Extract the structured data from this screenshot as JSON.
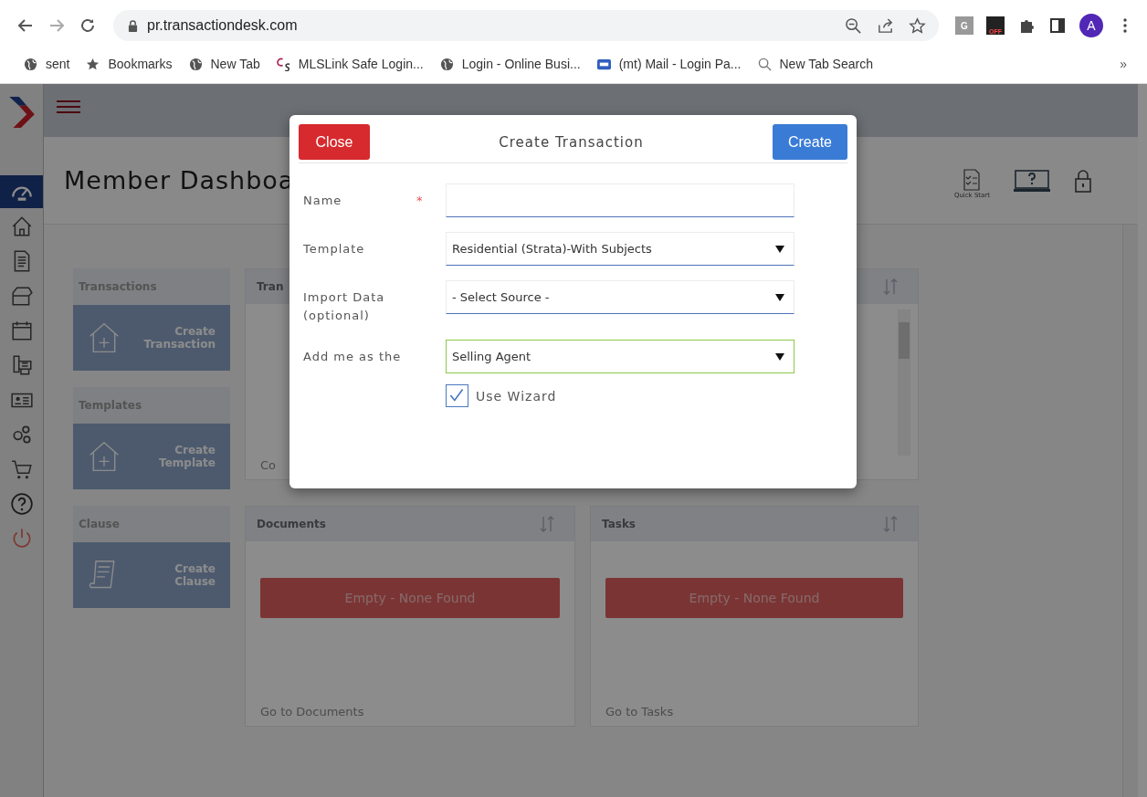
{
  "browser": {
    "url": "pr.transactiondesk.com",
    "extensions": [
      {
        "label": "G"
      },
      {
        "label": "OFF"
      }
    ],
    "avatar": "A",
    "bookmarks": [
      {
        "kind": "globe",
        "label": "sent"
      },
      {
        "kind": "star",
        "label": "Bookmarks"
      },
      {
        "kind": "globe",
        "label": "New Tab"
      },
      {
        "kind": "cs",
        "label": "MLSLink Safe Login..."
      },
      {
        "kind": "globe",
        "label": "Login - Online Busi..."
      },
      {
        "kind": "mail",
        "label": "(mt) Mail - Login Pa..."
      },
      {
        "kind": "search",
        "label": "New Tab Search"
      }
    ],
    "more": "»"
  },
  "sidebar": {
    "items": [
      {
        "kind": "gauge",
        "selected": true
      },
      {
        "kind": "home",
        "selected": false
      },
      {
        "kind": "doc",
        "selected": false
      },
      {
        "kind": "box",
        "selected": false
      },
      {
        "kind": "calendar",
        "selected": false
      },
      {
        "kind": "fax",
        "selected": false
      },
      {
        "kind": "card",
        "selected": false
      },
      {
        "kind": "gears",
        "selected": false
      },
      {
        "kind": "cart",
        "selected": false
      },
      {
        "kind": "help",
        "selected": false
      },
      {
        "kind": "power",
        "selected": false
      }
    ]
  },
  "header": {
    "title": "Member Dashboa",
    "quick_start": "Quick Start"
  },
  "tiles": [
    {
      "title": "Transactions",
      "action": "Create Transaction",
      "kind": "house"
    },
    {
      "title": "Templates",
      "action": "Create Template",
      "kind": "house"
    },
    {
      "title": "Clause",
      "action": "Create Clause",
      "kind": "scroll"
    }
  ],
  "panels": [
    {
      "title": "Tran",
      "footer": "Co"
    },
    {
      "scrollbar": true,
      "sortable": true
    },
    {
      "title": "Documents",
      "sortable": true,
      "empty": "Empty - None Found",
      "footer": "Go to Documents"
    },
    {
      "title": "Tasks",
      "sortable": true,
      "empty": "Empty - None Found",
      "footer": "Go to Tasks"
    }
  ],
  "dialog": {
    "title": "Create Transaction",
    "close": "Close",
    "create": "Create",
    "fields": [
      {
        "kind": "text",
        "label": "Name",
        "required_mark": "*",
        "valid": false
      },
      {
        "kind": "select",
        "label": "Template",
        "value": "Residential (Strata)-With Subjects",
        "valid": false
      },
      {
        "kind": "select",
        "label": "Import Data (optional)",
        "value": "- Select Source -",
        "valid": false
      },
      {
        "kind": "select",
        "label": "Add me as the",
        "value": "Selling Agent",
        "valid": true
      }
    ],
    "wizard": {
      "label": "Use Wizard",
      "checked": true
    }
  }
}
